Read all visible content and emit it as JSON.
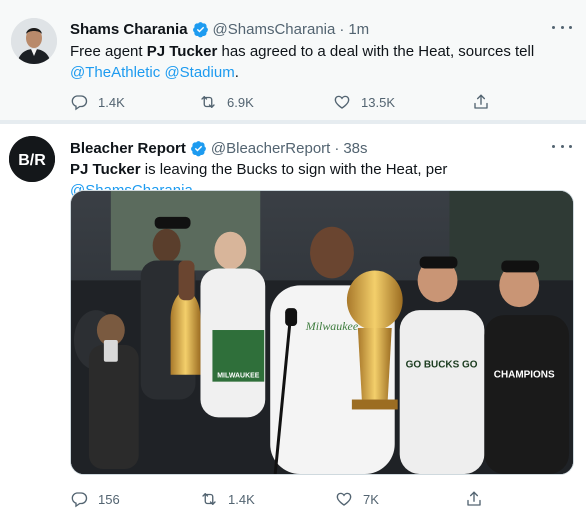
{
  "tweets": [
    {
      "name": "Shams Charania",
      "handle": "@ShamsCharania",
      "separator": "·",
      "time": "1m",
      "text_segments": [
        {
          "text": "Free agent ",
          "style": "plain"
        },
        {
          "text": "PJ Tucker",
          "style": "bold"
        },
        {
          "text": " has agreed to a deal with the Heat, sources tell ",
          "style": "plain"
        },
        {
          "text": "@TheAthletic",
          "style": "link"
        },
        {
          "text": " ",
          "style": "plain"
        },
        {
          "text": "@Stadium",
          "style": "link"
        },
        {
          "text": ".",
          "style": "plain"
        }
      ],
      "stats": {
        "replies": "1.4K",
        "retweets": "6.9K",
        "likes": "13.5K"
      }
    },
    {
      "name": "Bleacher Report",
      "handle": "@BleacherReport",
      "separator": "·",
      "time": "38s",
      "avatar_text": "B/R",
      "text_segments": [
        {
          "text": "PJ Tucker",
          "style": "bold"
        },
        {
          "text": " is leaving the Bucks to sign with the Heat, per ",
          "style": "plain"
        },
        {
          "text": "@ShamsCharania",
          "style": "link"
        }
      ],
      "stats": {
        "replies": "156",
        "retweets": "1.4K",
        "likes": "7K"
      },
      "media_text": {
        "sign": "MILWAUKEE",
        "shirt": "GO BUCKS GO",
        "champions": "CHAMPIONS",
        "tshirt": "Milwaukee"
      }
    }
  ],
  "colors": {
    "accent": "#1d9bf0",
    "secondary": "#536471",
    "background": "#e6ecf0"
  },
  "icons": [
    "verified-badge-icon",
    "more-icon",
    "reply-icon",
    "retweet-icon",
    "like-icon",
    "share-icon"
  ]
}
